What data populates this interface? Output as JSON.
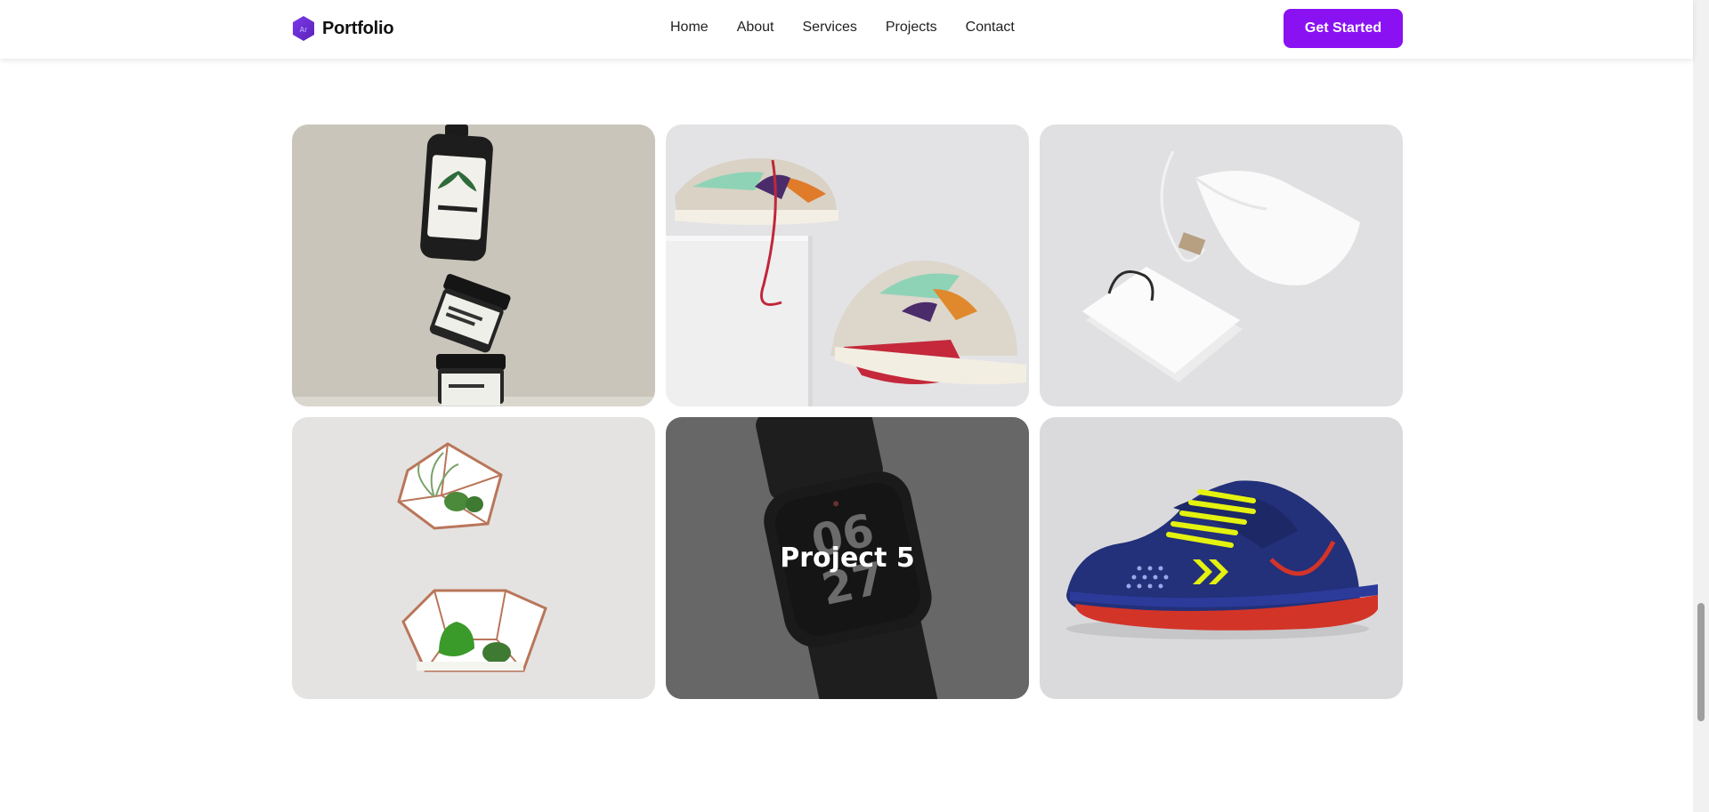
{
  "header": {
    "brand_name": "Portfolio",
    "brand_icon": "hexagon-logo-icon",
    "nav": [
      "Home",
      "About",
      "Services",
      "Projects",
      "Contact"
    ],
    "cta_label": "Get Started"
  },
  "colors": {
    "accent": "#8a12f2",
    "logo": "#6d28d9",
    "overlay": "#2a2a2a"
  },
  "projects": [
    {
      "image": "stacked skincare bottles and jars"
    },
    {
      "image": "sneakers on white blocks"
    },
    {
      "image": "white tote bag and drawstring pouch"
    },
    {
      "image": "geometric copper terrariums with plants"
    },
    {
      "image": "smartwatch with black strap",
      "overlay_title": "Project 5"
    },
    {
      "image": "blue and neon yellow football boot"
    }
  ]
}
